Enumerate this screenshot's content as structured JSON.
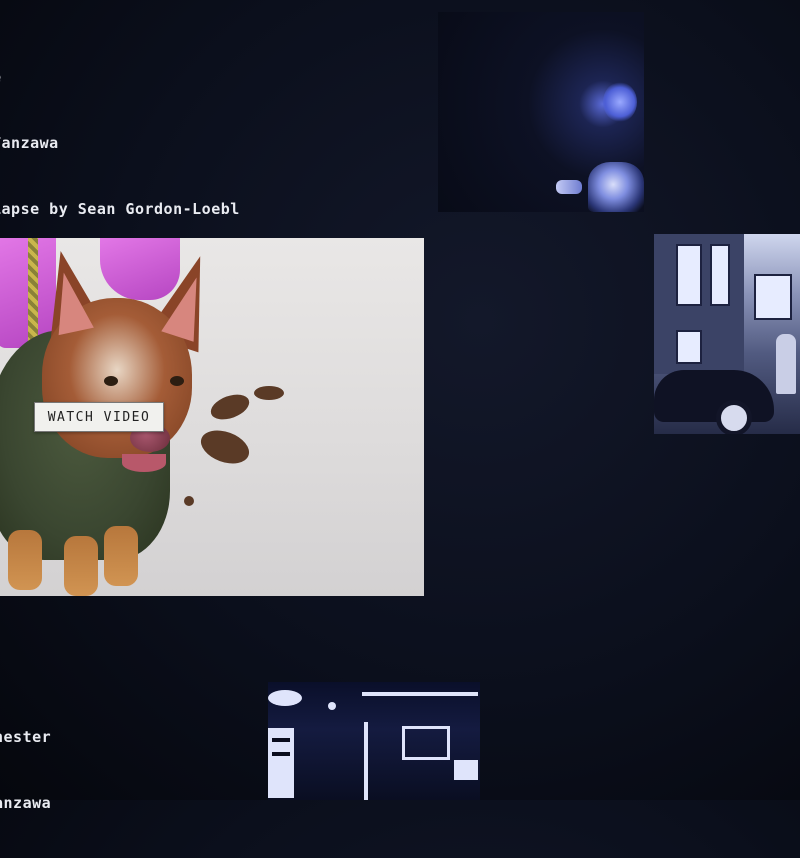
{
  "top_text": {
    "line1": "e",
    "line2": "Tanzawa",
    "line3": "Lapse by Sean Gordon-Loebl"
  },
  "bottom_text": {
    "line1": "hester",
    "line2": "anzawa"
  },
  "main_video": {
    "button_label": "WATCH VIDEO"
  },
  "colors": {
    "background": "#0b0f1c",
    "text": "#e9ebf1",
    "button_bg": "#f1f1ee"
  }
}
